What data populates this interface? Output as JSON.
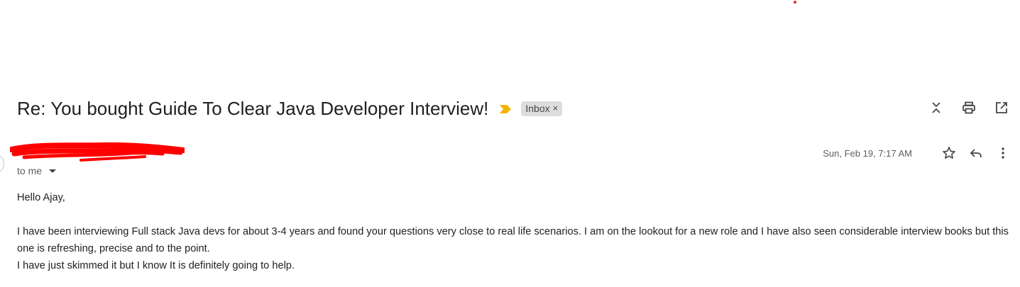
{
  "email": {
    "subject": "Re: You bought Guide To Clear Java Developer Interview!",
    "label": "Inbox",
    "label_remove": "×",
    "recipient": "to me",
    "date": "Sun, Feb 19, 7:17 AM",
    "body": {
      "greeting": "Hello Ajay,",
      "lines": [
        "I have been interviewing Full stack Java devs for about 3-4 years and found your questions very close to real life scenarios. I am on the lookout for a new role and I have also seen considerable interview books but this one is refreshing, precise and to the point.",
        "I have just skimmed it but I know It is definitely going to help."
      ]
    }
  },
  "icons": {
    "importance": "importance-marker-icon",
    "collapse": "collapse-all-icon",
    "print": "print-icon",
    "open_new": "open-in-new-window-icon",
    "star": "star-icon",
    "reply": "reply-icon",
    "more": "more-vert-icon"
  },
  "colors": {
    "importance": "#f4b400",
    "label_bg": "#dddddd",
    "redaction": "#ff0000",
    "text": "#202124",
    "muted": "#5e5e5e"
  }
}
